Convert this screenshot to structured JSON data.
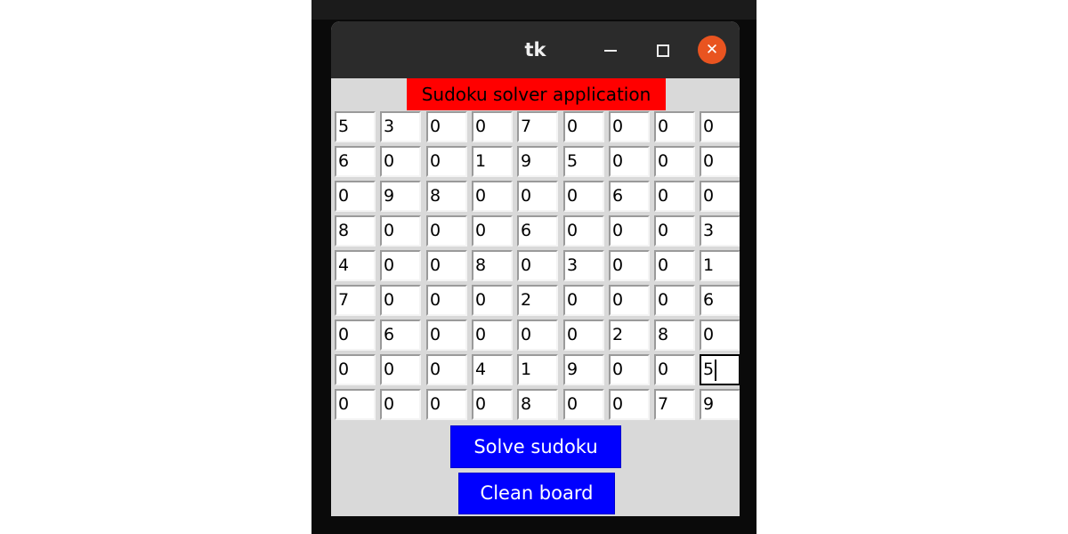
{
  "window": {
    "title": "tk",
    "controls": {
      "minimize_icon": "minimize-icon",
      "maximize_icon": "maximize-icon",
      "close_icon": "close-icon",
      "close_glyph": "✕"
    }
  },
  "app": {
    "title": "Sudoku solver application",
    "title_bg": "#ff0000"
  },
  "board": {
    "rows": [
      [
        "5",
        "3",
        "0",
        "0",
        "7",
        "0",
        "0",
        "0",
        "0"
      ],
      [
        "6",
        "0",
        "0",
        "1",
        "9",
        "5",
        "0",
        "0",
        "0"
      ],
      [
        "0",
        "9",
        "8",
        "0",
        "0",
        "0",
        "6",
        "0",
        "0"
      ],
      [
        "8",
        "0",
        "0",
        "0",
        "6",
        "0",
        "0",
        "0",
        "3"
      ],
      [
        "4",
        "0",
        "0",
        "8",
        "0",
        "3",
        "0",
        "0",
        "1"
      ],
      [
        "7",
        "0",
        "0",
        "0",
        "2",
        "0",
        "0",
        "0",
        "6"
      ],
      [
        "0",
        "6",
        "0",
        "0",
        "0",
        "0",
        "2",
        "8",
        "0"
      ],
      [
        "0",
        "0",
        "0",
        "4",
        "1",
        "9",
        "0",
        "0",
        "5"
      ],
      [
        "0",
        "0",
        "0",
        "0",
        "8",
        "0",
        "0",
        "7",
        "9"
      ]
    ],
    "focused_cell": [
      7,
      8
    ]
  },
  "buttons": {
    "solve_label": "Solve sudoku",
    "clean_label": "Clean board",
    "bg": "#0000ff"
  }
}
